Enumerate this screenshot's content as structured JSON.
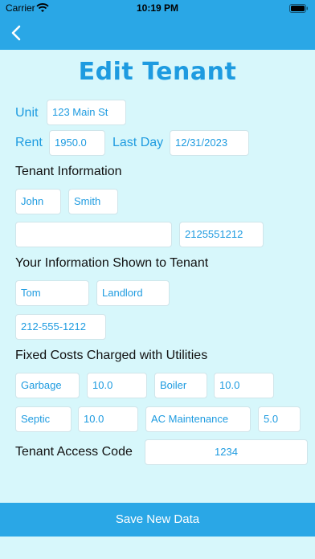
{
  "status": {
    "carrier": "Carrier",
    "time": "10:19 PM"
  },
  "icons": {
    "back": "chevron-left-icon",
    "wifi": "wifi-icon",
    "battery": "battery-icon"
  },
  "colors": {
    "accent": "#2aa7e6",
    "label": "#1e9be0",
    "background": "#d7f7fb"
  },
  "page": {
    "title": "Edit Tenant"
  },
  "unit": {
    "label": "Unit",
    "value": "123 Main St"
  },
  "rent": {
    "label": "Rent",
    "value": "1950.0"
  },
  "last_day": {
    "label": "Last Day",
    "value": "12/31/2023"
  },
  "tenant_info": {
    "heading": "Tenant Information",
    "first_name": "John",
    "last_name": "Smith",
    "email": "",
    "phone": "2125551212"
  },
  "your_info": {
    "heading": "Your Information Shown to Tenant",
    "first_name": "Tom",
    "last_name": "Landlord",
    "phone": "212-555-1212"
  },
  "fixed_costs": {
    "heading": "Fixed Costs Charged with Utilities",
    "items": [
      {
        "name": "Garbage",
        "amount": "10.0"
      },
      {
        "name": "Boiler",
        "amount": "10.0"
      },
      {
        "name": "Septic",
        "amount": "10.0"
      },
      {
        "name": "AC Maintenance",
        "amount": "5.0"
      }
    ]
  },
  "access_code": {
    "label": "Tenant Access Code",
    "value": "1234"
  },
  "save_button": {
    "label": "Save New Data"
  }
}
